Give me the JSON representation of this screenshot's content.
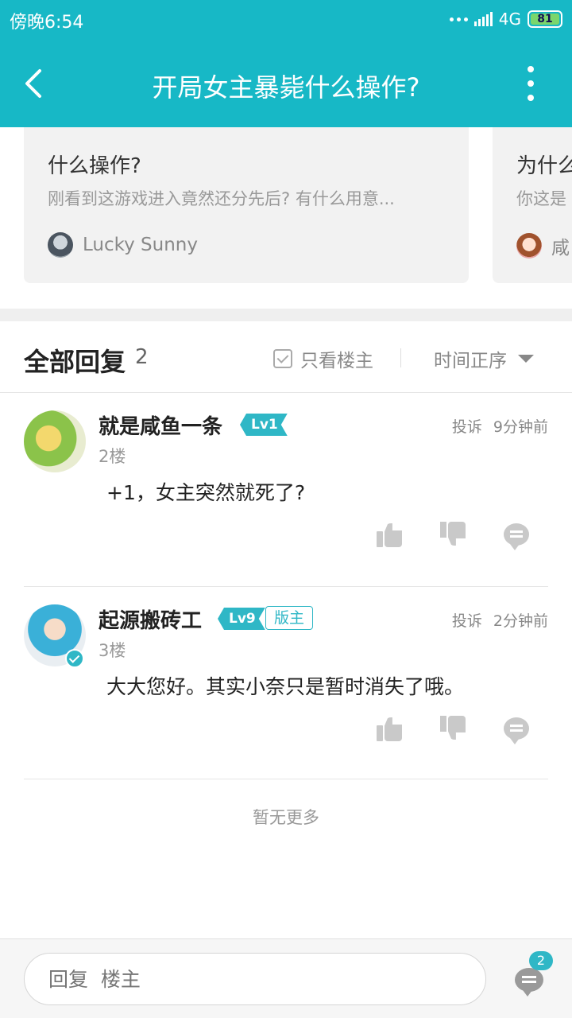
{
  "status_bar": {
    "time": "傍晚6:54",
    "network": "4G",
    "battery": "81"
  },
  "header": {
    "title": "开局女主暴毙什么操作?"
  },
  "related_cards": [
    {
      "title": "什么操作?",
      "desc": "刚看到这游戏进入竟然还分先后? 有什么用意...",
      "user": "Lucky Sunny"
    },
    {
      "title": "为什么",
      "desc": "你这是",
      "user": "咸"
    }
  ],
  "replies_header": {
    "title": "全部回复",
    "count": "2",
    "only_host": "只看楼主",
    "sort": "时间正序"
  },
  "replies": [
    {
      "username": "就是咸鱼一条",
      "level": "Lv1",
      "floor": "2楼",
      "report": "投诉",
      "time": "9分钟前",
      "content": "+1，女主突然就死了?"
    },
    {
      "username": "起源搬砖工",
      "level": "Lv9",
      "role": "版主",
      "floor": "3楼",
      "report": "投诉",
      "time": "2分钟前",
      "content": "大大您好。其实小奈只是暂时消失了哦。"
    }
  ],
  "no_more": "暂无更多",
  "bottom": {
    "placeholder": "回复  楼主",
    "comment_count": "2"
  },
  "colors": {
    "accent": "#17b8c6"
  }
}
